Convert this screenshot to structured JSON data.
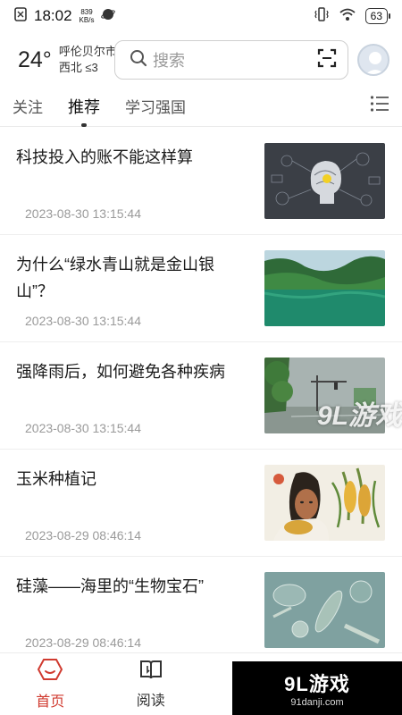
{
  "status_bar": {
    "time": "18:02",
    "net_speed_value": "839",
    "net_speed_unit": "KB/s",
    "battery": "63"
  },
  "header": {
    "temperature": "24°",
    "city": "呼伦贝尔市",
    "wind": "西北 ≤3",
    "search_placeholder": "搜索"
  },
  "tabs": [
    {
      "label": "关注",
      "active": false
    },
    {
      "label": "推荐",
      "active": true
    },
    {
      "label": "学习强国",
      "active": false
    }
  ],
  "news": [
    {
      "title": "科技投入的账不能这样算",
      "date": "2023-08-30 13:15:44"
    },
    {
      "title": "为什么“绿水青山就是金山银山”？",
      "date": "2023-08-30 13:15:44"
    },
    {
      "title": "强降雨后，如何避免各种疾病",
      "date": "2023-08-30 13:15:44"
    },
    {
      "title": "玉米种植记",
      "date": "2023-08-29 08:46:14"
    },
    {
      "title": "硅藻——海里的“生物宝石”",
      "date": "2023-08-29 08:46:14"
    }
  ],
  "bottom_nav": [
    {
      "label": "首页",
      "icon": "home-icon",
      "active": true
    },
    {
      "label": "阅读",
      "icon": "book-icon",
      "active": false
    }
  ],
  "watermark": {
    "title": "9L游戏",
    "subtitle": "91danji.com",
    "overlay": "9L游戏"
  },
  "colors": {
    "accent": "#d03a2f",
    "text": "#1a1a1a",
    "date": "#9a9a9a"
  }
}
